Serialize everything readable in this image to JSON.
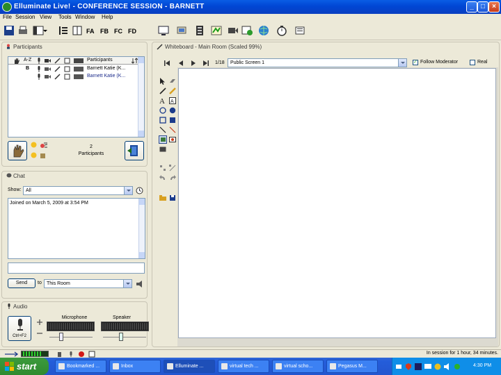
{
  "window": {
    "title": "Elluminate Live! - CONFERENCE SESSION - BARNETT"
  },
  "menu": [
    "File",
    "Session",
    "View",
    "Tools",
    "Window",
    "Help"
  ],
  "participants": {
    "title": "Participants",
    "col_header": "A-Z",
    "list_header": "Participants",
    "rows": [
      {
        "marker": "B",
        "name": "Barnett Katie (K..."
      },
      {
        "marker": "",
        "name": "Barnett Katie (K..."
      }
    ],
    "count": "2",
    "count_label": "Participants"
  },
  "chat": {
    "title": "Chat",
    "show_label": "Show:",
    "show_value": "All",
    "message": "Joined on March 5, 2009 at 3:54 PM",
    "send_label": "Send",
    "to_label": "to",
    "to_value": "This Room"
  },
  "audio": {
    "title": "Audio",
    "talk_label": "Ctrl+F2",
    "mic_label": "Microphone",
    "speaker_label": "Speaker",
    "mic_level": 0.28,
    "speaker_level": 0.42
  },
  "whiteboard": {
    "title": "Whiteboard - Main Room (Scaled 99%)",
    "page": "1/18",
    "screen": "Public Screen 1",
    "follow_label": "Follow Moderator",
    "follow_checked": true,
    "real_label": "Real",
    "real_checked": false
  },
  "status": {
    "text": "In session for 1 hour, 34 minutes."
  },
  "taskbar": {
    "start": "start",
    "tasks": [
      "Bookmarked ...",
      "Inbox",
      "Elluminate ...",
      "virtual tech ...",
      "virtual scho...",
      "Pegasus M..."
    ],
    "clock": "4:30 PM"
  },
  "colors": {
    "titlebar": "#0046d4",
    "taskbar": "#245dda",
    "start": "#2f8a2f",
    "panel_bg": "#ece9d8"
  }
}
